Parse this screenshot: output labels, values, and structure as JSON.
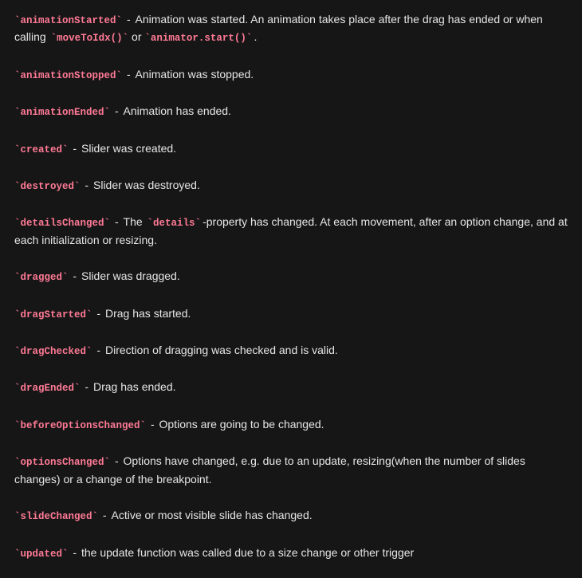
{
  "sep": " - ",
  "events": [
    {
      "key": "animationStarted",
      "desc_pre": "Animation was started. An animation takes place after the drag has ended or when calling ",
      "codes": [
        "moveToIdx()",
        "animator.start()"
      ],
      "joiner": " or ",
      "desc_post": "."
    },
    {
      "key": "animationStopped",
      "desc_pre": "Animation was stopped.",
      "codes": [],
      "joiner": "",
      "desc_post": ""
    },
    {
      "key": "animationEnded",
      "desc_pre": "Animation has ended.",
      "codes": [],
      "joiner": "",
      "desc_post": ""
    },
    {
      "key": "created",
      "desc_pre": "Slider was created.",
      "codes": [],
      "joiner": "",
      "desc_post": ""
    },
    {
      "key": "destroyed",
      "desc_pre": "Slider was destroyed.",
      "codes": [],
      "joiner": "",
      "desc_post": ""
    },
    {
      "key": "detailsChanged",
      "desc_pre": "The ",
      "codes": [
        "details"
      ],
      "joiner": "",
      "desc_post": "-property has changed. At each movement, after an option change, and at each initialization or resizing."
    },
    {
      "key": "dragged",
      "desc_pre": "Slider was dragged.",
      "codes": [],
      "joiner": "",
      "desc_post": ""
    },
    {
      "key": "dragStarted",
      "desc_pre": "Drag has started.",
      "codes": [],
      "joiner": "",
      "desc_post": ""
    },
    {
      "key": "dragChecked",
      "desc_pre": "Direction of dragging was checked and is valid.",
      "codes": [],
      "joiner": "",
      "desc_post": ""
    },
    {
      "key": "dragEnded",
      "desc_pre": "Drag has ended.",
      "codes": [],
      "joiner": "",
      "desc_post": ""
    },
    {
      "key": "beforeOptionsChanged",
      "desc_pre": "Options are going to be changed.",
      "codes": [],
      "joiner": "",
      "desc_post": ""
    },
    {
      "key": "optionsChanged",
      "desc_pre": "Options have changed, e.g. due to an update, resizing(when the number of slides changes) or a change of the breakpoint.",
      "codes": [],
      "joiner": "",
      "desc_post": ""
    },
    {
      "key": "slideChanged",
      "desc_pre": "Active or most visible slide has changed.",
      "codes": [],
      "joiner": "",
      "desc_post": ""
    },
    {
      "key": "updated",
      "desc_pre": "the update function was called due to a size change or other trigger",
      "codes": [],
      "joiner": "",
      "desc_post": ""
    }
  ]
}
